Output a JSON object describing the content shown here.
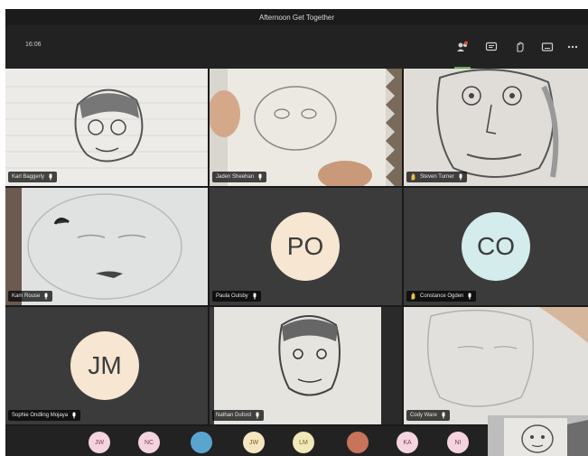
{
  "window": {
    "title": "Afternoon Get Together"
  },
  "toolbar": {
    "timer": "16:06"
  },
  "participants": [
    {
      "name": "Karl Baggerly",
      "bg": "#e8e7e3"
    },
    {
      "name": "Jaden Sheehan",
      "bg": "#dcd8d0"
    },
    {
      "name": "Steven Turner",
      "bg": "#dedad6",
      "hand": true
    },
    {
      "name": "Kam Rouse",
      "bg": "#d6dad8"
    },
    {
      "name": "Paula Oulsby",
      "initials": "PO",
      "avatar_color": "#f6e6d2"
    },
    {
      "name": "Constance Ogden",
      "initials": "CO",
      "avatar_color": "#d5ecec",
      "hand": true
    },
    {
      "name": "Sophie Ondling Mojaya",
      "initials": "JM",
      "avatar_color": "#f6e6d2"
    },
    {
      "name": "Nathan Duford",
      "bg": "#e3e1dc"
    },
    {
      "name": "Cody Ware",
      "bg": "#e2e0dc"
    }
  ],
  "tray": [
    {
      "initials": "JW",
      "color": "#f4d4de"
    },
    {
      "initials": "NC",
      "color": "#f4d4de"
    },
    {
      "initials": "",
      "color": "#5aa5d0"
    },
    {
      "initials": "JW",
      "color": "#f6e6c0"
    },
    {
      "initials": "LM",
      "color": "#f0e8b8"
    },
    {
      "initials": "",
      "color": "#c8735a"
    },
    {
      "initials": "KA",
      "color": "#f4d4de"
    },
    {
      "initials": "NI",
      "color": "#f4d4de"
    }
  ],
  "colors": {
    "accent_green": "#5fb14d",
    "mic_icon": "#ffffff",
    "hand_icon": "#e8c14a"
  }
}
